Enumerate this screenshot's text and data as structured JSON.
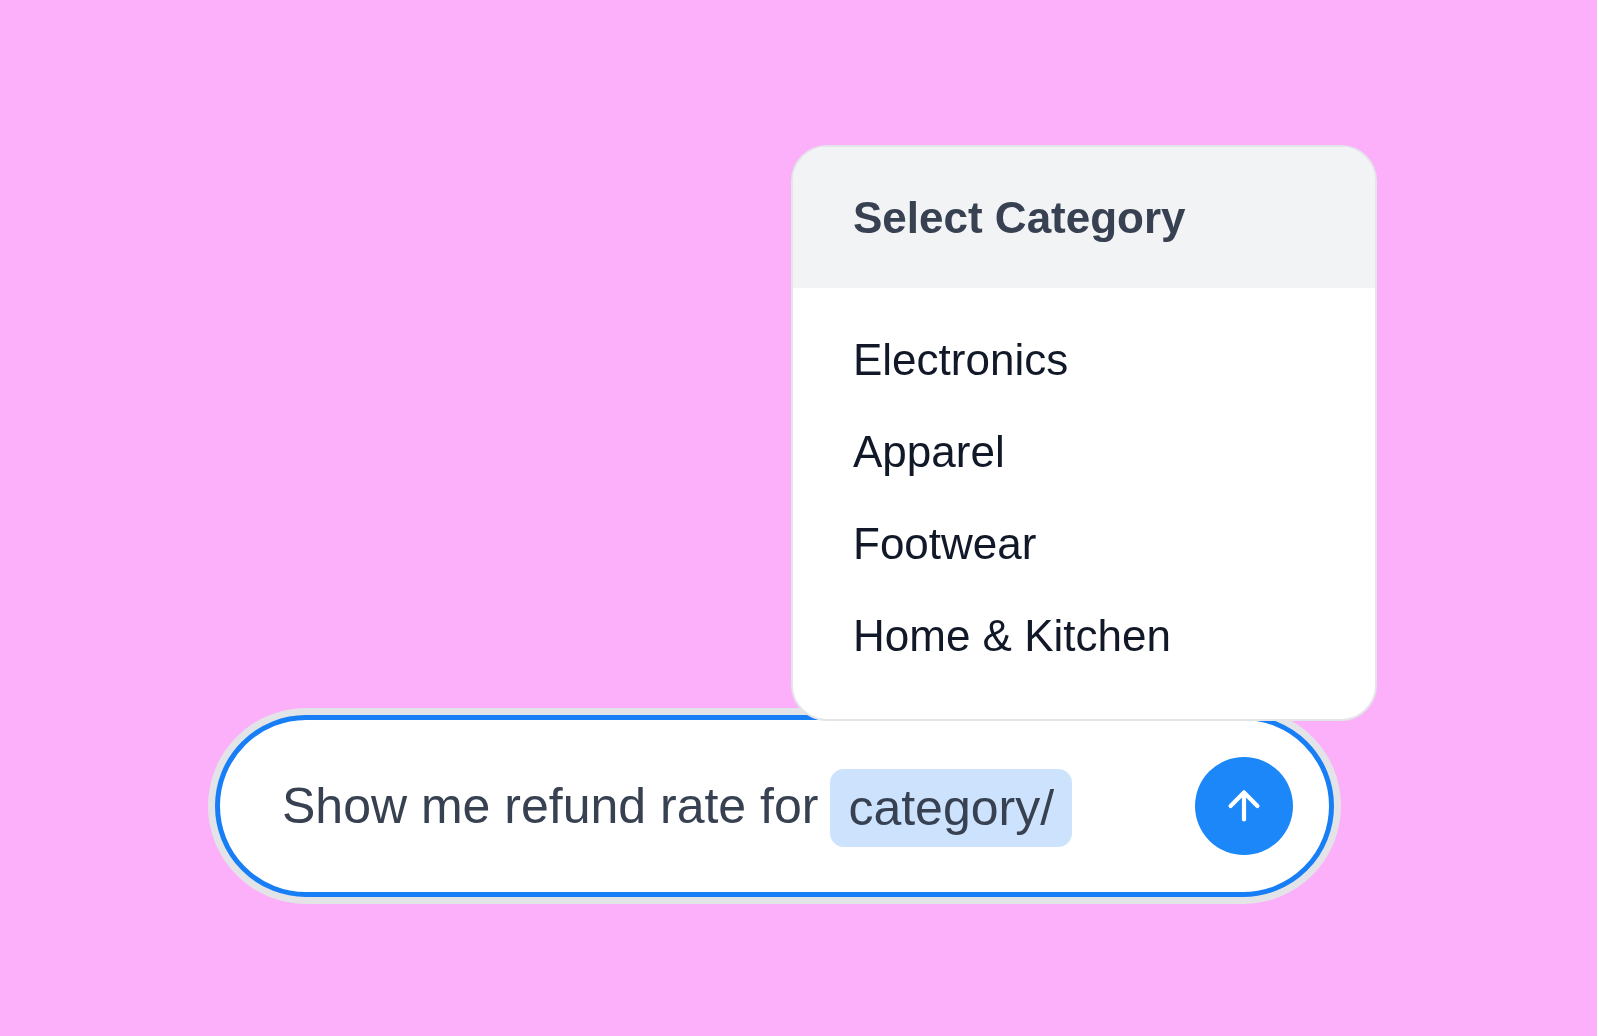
{
  "dropdown": {
    "title": "Select Category",
    "items": [
      {
        "label": "Electronics",
        "selected": false
      },
      {
        "label": "Apparel",
        "selected": false
      },
      {
        "label": "Footwear",
        "selected": false
      },
      {
        "label": "Home & Kitchen",
        "selected": false
      }
    ]
  },
  "composer": {
    "value": "Show me refund rate for",
    "token": "category/"
  }
}
